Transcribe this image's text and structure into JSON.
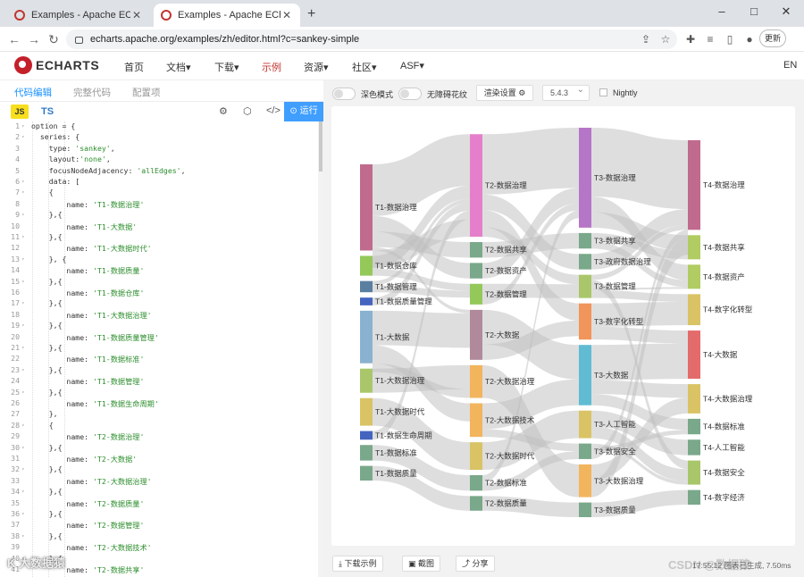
{
  "browser": {
    "tabs": [
      {
        "title": "Examples - Apache ECharts",
        "active": false
      },
      {
        "title": "Examples - Apache ECharts",
        "active": true
      }
    ],
    "new_tab": "+",
    "window_controls": {
      "minimize": "–",
      "maximize": "□",
      "close": "✕"
    },
    "url": "echarts.apache.org/examples/zh/editor.html?c=sankey-simple",
    "update_button": "更新"
  },
  "site": {
    "logo_text": "ECHARTS",
    "nav": [
      {
        "label": "首页",
        "active": false
      },
      {
        "label": "文档▾",
        "active": false
      },
      {
        "label": "下载▾",
        "active": false
      },
      {
        "label": "示例",
        "active": true
      },
      {
        "label": "资源▾",
        "active": false
      },
      {
        "label": "社区▾",
        "active": false
      },
      {
        "label": "ASF▾",
        "active": false
      }
    ],
    "language": "EN"
  },
  "editor": {
    "tabs": [
      {
        "label": "代码编辑",
        "active": true
      },
      {
        "label": "完整代码",
        "active": false
      },
      {
        "label": "配置项",
        "active": false
      }
    ],
    "js_badge": "JS",
    "ts_label": "TS",
    "run_button": "运行",
    "lines": [
      {
        "n": "1",
        "f": "▾",
        "text": "option = {"
      },
      {
        "n": "2",
        "f": "▾",
        "text": "  series: {"
      },
      {
        "n": "3",
        "f": "",
        "text": "    type: 'sankey',"
      },
      {
        "n": "4",
        "f": "",
        "text": "    layout:'none',"
      },
      {
        "n": "5",
        "f": "",
        "text": "    focusNodeAdjacency: 'allEdges',"
      },
      {
        "n": "6",
        "f": "▾",
        "text": "    data: ["
      },
      {
        "n": "7",
        "f": "▾",
        "text": "    {"
      },
      {
        "n": "8",
        "f": "",
        "text": "        name: 'T1-数据治理'"
      },
      {
        "n": "9",
        "f": "▾",
        "text": "    },{"
      },
      {
        "n": "10",
        "f": "",
        "text": "        name: 'T1-大数据'"
      },
      {
        "n": "11",
        "f": "▾",
        "text": "    },{"
      },
      {
        "n": "12",
        "f": "",
        "text": "        name: 'T1-大数据时代'"
      },
      {
        "n": "13",
        "f": "▾",
        "text": "    }, {"
      },
      {
        "n": "14",
        "f": "",
        "text": "        name: 'T1-数据质量'"
      },
      {
        "n": "15",
        "f": "▾",
        "text": "    },{"
      },
      {
        "n": "16",
        "f": "",
        "text": "        name: 'T1-数据仓库'"
      },
      {
        "n": "17",
        "f": "▾",
        "text": "    },{"
      },
      {
        "n": "18",
        "f": "",
        "text": "        name: 'T1-大数据治理'"
      },
      {
        "n": "19",
        "f": "▾",
        "text": "    },{"
      },
      {
        "n": "20",
        "f": "",
        "text": "        name: 'T1-数据质量管理'"
      },
      {
        "n": "21",
        "f": "▾",
        "text": "    },{"
      },
      {
        "n": "22",
        "f": "",
        "text": "        name: 'T1-数据标准'"
      },
      {
        "n": "23",
        "f": "▾",
        "text": "    },{"
      },
      {
        "n": "24",
        "f": "",
        "text": "        name: 'T1-数据管理'"
      },
      {
        "n": "25",
        "f": "▾",
        "text": "    },{"
      },
      {
        "n": "26",
        "f": "",
        "text": "        name: 'T1-数据生命周期'"
      },
      {
        "n": "27",
        "f": "",
        "text": "    },"
      },
      {
        "n": "28",
        "f": "▾",
        "text": "    {"
      },
      {
        "n": "29",
        "f": "",
        "text": "        name: 'T2-数据治理'"
      },
      {
        "n": "30",
        "f": "▾",
        "text": "    },{"
      },
      {
        "n": "31",
        "f": "",
        "text": "        name: 'T2-大数据'"
      },
      {
        "n": "32",
        "f": "▾",
        "text": "    },{"
      },
      {
        "n": "33",
        "f": "",
        "text": "        name: 'T2-大数据治理'"
      },
      {
        "n": "34",
        "f": "▾",
        "text": "    },{"
      },
      {
        "n": "35",
        "f": "",
        "text": "        name: 'T2-数据质量'"
      },
      {
        "n": "36",
        "f": "▾",
        "text": "    },{"
      },
      {
        "n": "37",
        "f": "",
        "text": "        name: 'T2-数据管理'"
      },
      {
        "n": "38",
        "f": "▾",
        "text": "    },{"
      },
      {
        "n": "39",
        "f": "",
        "text": "        name: 'T2-大数据技术'"
      },
      {
        "n": "40",
        "f": "▾",
        "text": "    },{"
      },
      {
        "n": "41",
        "f": "",
        "text": "        name: 'T2-数据共享'"
      }
    ]
  },
  "preview": {
    "dark_mode_label": "深色模式",
    "no_decal_label": "无障碍花纹",
    "render_settings": "渲染设置 ⚙",
    "version": "5.4.3",
    "nightly_label": "Nightly",
    "download_button": "下载示例",
    "screenshot_button": "截图",
    "share_button": "分享",
    "status_text": "17:55:12  图表已生成, 7.50ms",
    "watermark": "K 大数据猿",
    "csdn_watermark": "CSDN @数据猿"
  },
  "chart_data": {
    "type": "sankey",
    "columns": [
      {
        "level": "T1",
        "nodes": [
          {
            "name": "T1-数据治理",
            "value": 100,
            "color": "#c06a8e"
          },
          {
            "name": "T1-数据仓库",
            "value": 23,
            "color": "#94c95a"
          },
          {
            "name": "T1-数据管理",
            "value": 13,
            "color": "#5a7fa1"
          },
          {
            "name": "T1-数据质量管理",
            "value": 9,
            "color": "#4464c0"
          },
          {
            "name": "T1-大数据",
            "value": 61,
            "color": "#8ab2d0"
          },
          {
            "name": "T1-大数据治理",
            "value": 28,
            "color": "#a9c76a"
          },
          {
            "name": "T1-大数据时代",
            "value": 32,
            "color": "#d9c365"
          },
          {
            "name": "T1-数据生命周期",
            "value": 10,
            "color": "#4464c0"
          },
          {
            "name": "T1-数据标准",
            "value": 18,
            "color": "#7aa88a"
          },
          {
            "name": "T1-数据质量",
            "value": 17,
            "color": "#7aa88a"
          }
        ]
      },
      {
        "level": "T2",
        "nodes": [
          {
            "name": "T2-数据治理",
            "value": 119,
            "color": "#e57fcb"
          },
          {
            "name": "T2-数据共享",
            "value": 18,
            "color": "#7aa88a"
          },
          {
            "name": "T2-数据资产",
            "value": 18,
            "color": "#7aa88a"
          },
          {
            "name": "T2-数据管理",
            "value": 24,
            "color": "#94c95a"
          },
          {
            "name": "T2-大数据",
            "value": 58,
            "color": "#b08a9a"
          },
          {
            "name": "T2-大数据治理",
            "value": 38,
            "color": "#f2b45c"
          },
          {
            "name": "T2-大数据技术",
            "value": 39,
            "color": "#f2b45c"
          },
          {
            "name": "T2-大数据时代",
            "value": 32,
            "color": "#d9c365"
          },
          {
            "name": "T2-数据标准",
            "value": 18,
            "color": "#7aa88a"
          },
          {
            "name": "T2-数据质量",
            "value": 17,
            "color": "#7aa88a"
          }
        ]
      },
      {
        "level": "T3",
        "nodes": [
          {
            "name": "T3-数据治理",
            "value": 116,
            "color": "#b676c7"
          },
          {
            "name": "T3-数据共享",
            "value": 18,
            "color": "#7aa88a"
          },
          {
            "name": "T3-政府数据治理",
            "value": 18,
            "color": "#7aa88a"
          },
          {
            "name": "T3-数据管理",
            "value": 27,
            "color": "#a9c76a"
          },
          {
            "name": "T3-数字化转型",
            "value": 42,
            "color": "#f2955a"
          },
          {
            "name": "T3-大数据",
            "value": 70,
            "color": "#5fbcd3"
          },
          {
            "name": "T3-人工智能",
            "value": 32,
            "color": "#d9c365"
          },
          {
            "name": "T3-数据安全",
            "value": 18,
            "color": "#7aa88a"
          },
          {
            "name": "T3-大数据治理",
            "value": 38,
            "color": "#f2b45c"
          },
          {
            "name": "T3-数据质量",
            "value": 17,
            "color": "#7aa88a"
          }
        ]
      },
      {
        "level": "T4",
        "nodes": [
          {
            "name": "T4-数据治理",
            "value": 104,
            "color": "#c06a8e"
          },
          {
            "name": "T4-数据共享",
            "value": 28,
            "color": "#b1cc62"
          },
          {
            "name": "T4-数据资产",
            "value": 28,
            "color": "#b1cc62"
          },
          {
            "name": "T4-数字化转型",
            "value": 36,
            "color": "#d9c365"
          },
          {
            "name": "T4-大数据",
            "value": 56,
            "color": "#e46b6b"
          },
          {
            "name": "T4-大数据治理",
            "value": 34,
            "color": "#d9c365"
          },
          {
            "name": "T4-数据标准",
            "value": 18,
            "color": "#7aa88a"
          },
          {
            "name": "T4-人工智能",
            "value": 18,
            "color": "#7aa88a"
          },
          {
            "name": "T4-数据安全",
            "value": 28,
            "color": "#a9c76a"
          },
          {
            "name": "T4-数字经济",
            "value": 17,
            "color": "#7aa88a"
          }
        ]
      }
    ],
    "links": [
      [
        "T1-数据治理",
        "T2-数据治理",
        60
      ],
      [
        "T1-数据治理",
        "T2-数据资产",
        18
      ],
      [
        "T1-数据治理",
        "T2-数据共享",
        18
      ],
      [
        "T1-数据治理",
        "T2-大数据",
        4
      ],
      [
        "T1-数据仓库",
        "T2-数据治理",
        15
      ],
      [
        "T1-数据仓库",
        "T2-数据管理",
        8
      ],
      [
        "T1-数据管理",
        "T2-数据治理",
        5
      ],
      [
        "T1-数据管理",
        "T2-数据管理",
        8
      ],
      [
        "T1-数据质量管理",
        "T2-数据治理",
        9
      ],
      [
        "T1-大数据",
        "T2-大数据",
        40
      ],
      [
        "T1-大数据",
        "T2-大数据技术",
        21
      ],
      [
        "T1-大数据治理",
        "T2-大数据治理",
        28
      ],
      [
        "T1-大数据时代",
        "T2-大数据时代",
        32
      ],
      [
        "T1-数据生命周期",
        "T2-数据治理",
        10
      ],
      [
        "T1-数据标准",
        "T2-数据标准",
        18
      ],
      [
        "T1-数据质量",
        "T2-数据质量",
        17
      ],
      [
        "T1-数据治理",
        "T2-数据治理",
        20
      ],
      [
        "T1-大数据",
        "T2-大数据治理",
        10
      ],
      [
        "T1-数据仓库",
        "T2-大数据",
        0
      ],
      [
        "T1-数据管理",
        "T2-大数据技术",
        0
      ],
      [
        "T2-数据治理",
        "T3-数据治理",
        70
      ],
      [
        "T2-数据治理",
        "T3-政府数据治理",
        18
      ],
      [
        "T2-数据治理",
        "T3-数字化转型",
        20
      ],
      [
        "T2-数据治理",
        "T3-数据管理",
        11
      ],
      [
        "T2-数据共享",
        "T3-数据共享",
        18
      ],
      [
        "T2-数据资产",
        "T3-数据治理",
        18
      ],
      [
        "T2-数据管理",
        "T3-数据管理",
        16
      ],
      [
        "T2-数据管理",
        "T3-数据治理",
        8
      ],
      [
        "T2-大数据",
        "T3-大数据",
        40
      ],
      [
        "T2-大数据",
        "T3-数字化转型",
        18
      ],
      [
        "T2-大数据治理",
        "T3-大数据治理",
        38
      ],
      [
        "T2-大数据技术",
        "T3-大数据",
        30
      ],
      [
        "T2-大数据技术",
        "T3-数据安全",
        9
      ],
      [
        "T2-大数据时代",
        "T3-人工智能",
        32
      ],
      [
        "T2-数据标准",
        "T3-数据治理",
        9
      ],
      [
        "T2-数据标准",
        "T3-数据安全",
        9
      ],
      [
        "T2-数据质量",
        "T3-数据质量",
        17
      ],
      [
        "T2-数据治理",
        "T3-数据治理",
        0
      ],
      [
        "T3-数据治理",
        "T4-数据治理",
        80
      ],
      [
        "T3-数据治理",
        "T4-数据资产",
        18
      ],
      [
        "T3-数据治理",
        "T4-数据共享",
        18
      ],
      [
        "T3-数据共享",
        "T4-数据共享",
        10
      ],
      [
        "T3-数据共享",
        "T4-数据资产",
        8
      ],
      [
        "T3-政府数据治理",
        "T4-数据治理",
        18
      ],
      [
        "T3-数据管理",
        "T4-数据治理",
        6
      ],
      [
        "T3-数据管理",
        "T4-数据安全",
        10
      ],
      [
        "T3-数据管理",
        "T4-数据资产",
        2
      ],
      [
        "T3-数据管理",
        "T4-数字化转型",
        9
      ],
      [
        "T3-数字化转型",
        "T4-数字化转型",
        27
      ],
      [
        "T3-数字化转型",
        "T4-大数据",
        15
      ],
      [
        "T3-大数据",
        "T4-大数据",
        41
      ],
      [
        "T3-大数据",
        "T4-大数据治理",
        16
      ],
      [
        "T3-大数据",
        "T4-数据标准",
        13
      ],
      [
        "T3-人工智能",
        "T4-人工智能",
        18
      ],
      [
        "T3-人工智能",
        "T4-数据安全",
        14
      ],
      [
        "T3-数据安全",
        "T4-数据安全",
        4
      ],
      [
        "T3-数据安全",
        "T4-数据标准",
        5
      ],
      [
        "T3-数据安全",
        "T4-数据治理",
        9
      ],
      [
        "T3-大数据治理",
        "T4-大数据治理",
        18
      ],
      [
        "T3-大数据治理",
        "T4-数据治理",
        20
      ],
      [
        "T3-数据质量",
        "T4-数字经济",
        17
      ]
    ]
  }
}
